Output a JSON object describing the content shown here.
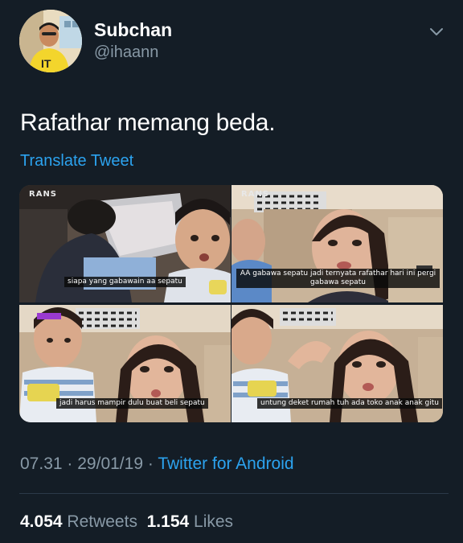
{
  "user": {
    "display_name": "Subchan",
    "handle": "@ihaann",
    "avatar_icon": "avatar-photo"
  },
  "tweet": {
    "text": "Rafathar memang beda.",
    "translate_label": "Translate Tweet",
    "time": "07.31",
    "separator": "·",
    "date": "29/01/19",
    "source": "Twitter for Android"
  },
  "media": {
    "images": [
      {
        "watermark": "RANS",
        "caption": "siapa yang gabawain aa sepatu"
      },
      {
        "watermark": "RANS",
        "caption": "AA gabawa sepatu jadi ternyata rafathar hari ini pergi gabawa sepatu"
      },
      {
        "watermark": "",
        "caption": "jadi harus mampir dulu buat beli sepatu"
      },
      {
        "watermark": "",
        "caption": "untung deket rumah tuh ada toko anak anak gitu"
      }
    ]
  },
  "stats": {
    "retweets_count": "4.054",
    "retweets_label": "Retweets",
    "likes_count": "1.154",
    "likes_label": "Likes"
  },
  "colors": {
    "background": "#141d26",
    "link": "#2ca3ef",
    "secondary_text": "#8899a6",
    "primary_text": "#ffffff"
  },
  "icons": {
    "menu": "chevron-down-icon"
  }
}
